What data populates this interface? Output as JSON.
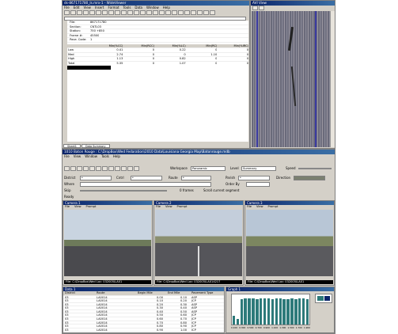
{
  "top_window": {
    "title": "ds-867171780_Is.mrx-1 - WideViewer",
    "menu": [
      "File",
      "Edit",
      "View",
      "Insert",
      "Format",
      "Tools",
      "Data",
      "Window",
      "Help"
    ],
    "sheet": {
      "info_labels": [
        "File",
        "Section",
        "Station",
        "Frame #",
        "Pave. Code"
      ],
      "info_values": [
        "867171780",
        "CNTL03",
        "750 +850",
        "45500",
        "1"
      ],
      "col_headers": [
        "",
        "Min(%CC)",
        "Min(RCC)",
        "Min(%LC)",
        "Min(RC)",
        "Min(%IRC)"
      ],
      "rows": [
        [
          "Low",
          "0.41",
          "0",
          "0.22",
          "0",
          "0"
        ],
        [
          "Med",
          "2.74",
          "0",
          "0",
          "1.10",
          "0"
        ],
        [
          "High",
          "1.13",
          "0",
          "0.82",
          "0",
          "0"
        ],
        [
          "Total",
          "5.35",
          "0",
          "1.07",
          "0",
          "0"
        ]
      ]
    },
    "sheet_tabs": [
      "Sheet1",
      "Data Summary"
    ],
    "status": "Ready"
  },
  "side_image_window": {
    "title": "AVI View"
  },
  "main_window": {
    "title": "1010 Baton Rouge : C:\\DropBox\\Wed Fedaration\\2010 Data\\Louisiana Georgia Map\\Batonrouge.mdb",
    "menu": [
      "File",
      "View",
      "Window",
      "Tools",
      "Help"
    ],
    "workspace_label": "Workspace",
    "workspace_value": "Panoramic",
    "level_label": "Level",
    "level_value": "Summary",
    "speed_label": "Speed",
    "district_label": "District",
    "district_value": "*",
    "control_label": "Cntrl",
    "control_value": "*",
    "route_label": "Route",
    "route_value": "*",
    "parish_label": "Parish",
    "parish_value": "*",
    "direction_label": "Direction",
    "where_label": "Where",
    "orderby_label": "Order By",
    "skip_label": "Skip",
    "frames_label": "0 frames",
    "scroll_label": "Scroll current segment",
    "status": "Ready"
  },
  "cameras": [
    {
      "title": "Camera 1",
      "menu": [
        "File",
        "View",
        "Prompt"
      ],
      "status": "File: C:\\DropBox\\Wed Loc: 032005\\LA01"
    },
    {
      "title": "Camera 2",
      "menu": [
        "File",
        "View",
        "Prompt"
      ],
      "status": "File: C:\\DropBox\\Wed Loc: 032005\\LA014217"
    },
    {
      "title": "Camera 3",
      "menu": [
        "File",
        "View",
        "Prompt"
      ],
      "status": "File: C:\\DropBox\\Wed Loc: 032005\\LA01"
    }
  ],
  "data_table": {
    "title": "Data 1",
    "headers": [
      "District",
      "Route",
      "Begin Mile",
      "End Mile",
      "Pavement Type"
    ],
    "rows": [
      [
        "03",
        "LA0014",
        "0.00",
        "0.10",
        "ASP"
      ],
      [
        "03",
        "LA0014",
        "0.10",
        "0.20",
        "JCP"
      ],
      [
        "03",
        "LA0014",
        "0.20",
        "0.30",
        "ASP"
      ],
      [
        "03",
        "LA0014",
        "0.30",
        "0.40",
        "ASP"
      ],
      [
        "03",
        "LA0014",
        "0.40",
        "0.50",
        "ASP"
      ],
      [
        "03",
        "LA0014",
        "0.50",
        "0.60",
        "JCP"
      ],
      [
        "03",
        "LA0014",
        "0.60",
        "0.70",
        "JCP"
      ],
      [
        "03",
        "LA0014",
        "0.70",
        "0.80",
        "JCP"
      ],
      [
        "03",
        "LA0014",
        "0.80",
        "0.90",
        "JCP"
      ],
      [
        "03",
        "LA0014",
        "0.90",
        "1.00",
        "JCP"
      ]
    ]
  },
  "graph_window": {
    "title": "Graph 1",
    "chart_data": {
      "type": "bar",
      "x": [
        "0.100",
        "0.300",
        "0.500",
        "0.700",
        "0.900",
        "1.100",
        "1.300",
        "1.500",
        "1.700",
        "1.900"
      ],
      "values": [
        30,
        18,
        85,
        88,
        86,
        87,
        85,
        88,
        86,
        87,
        85,
        86,
        87,
        85,
        84,
        86,
        85,
        87,
        86,
        85
      ],
      "ylim": [
        0,
        100
      ]
    }
  },
  "colors": {
    "title_bar": "#0a246a",
    "window_bg": "#d4d0c8",
    "graph_bar": "#2d7a7a"
  }
}
